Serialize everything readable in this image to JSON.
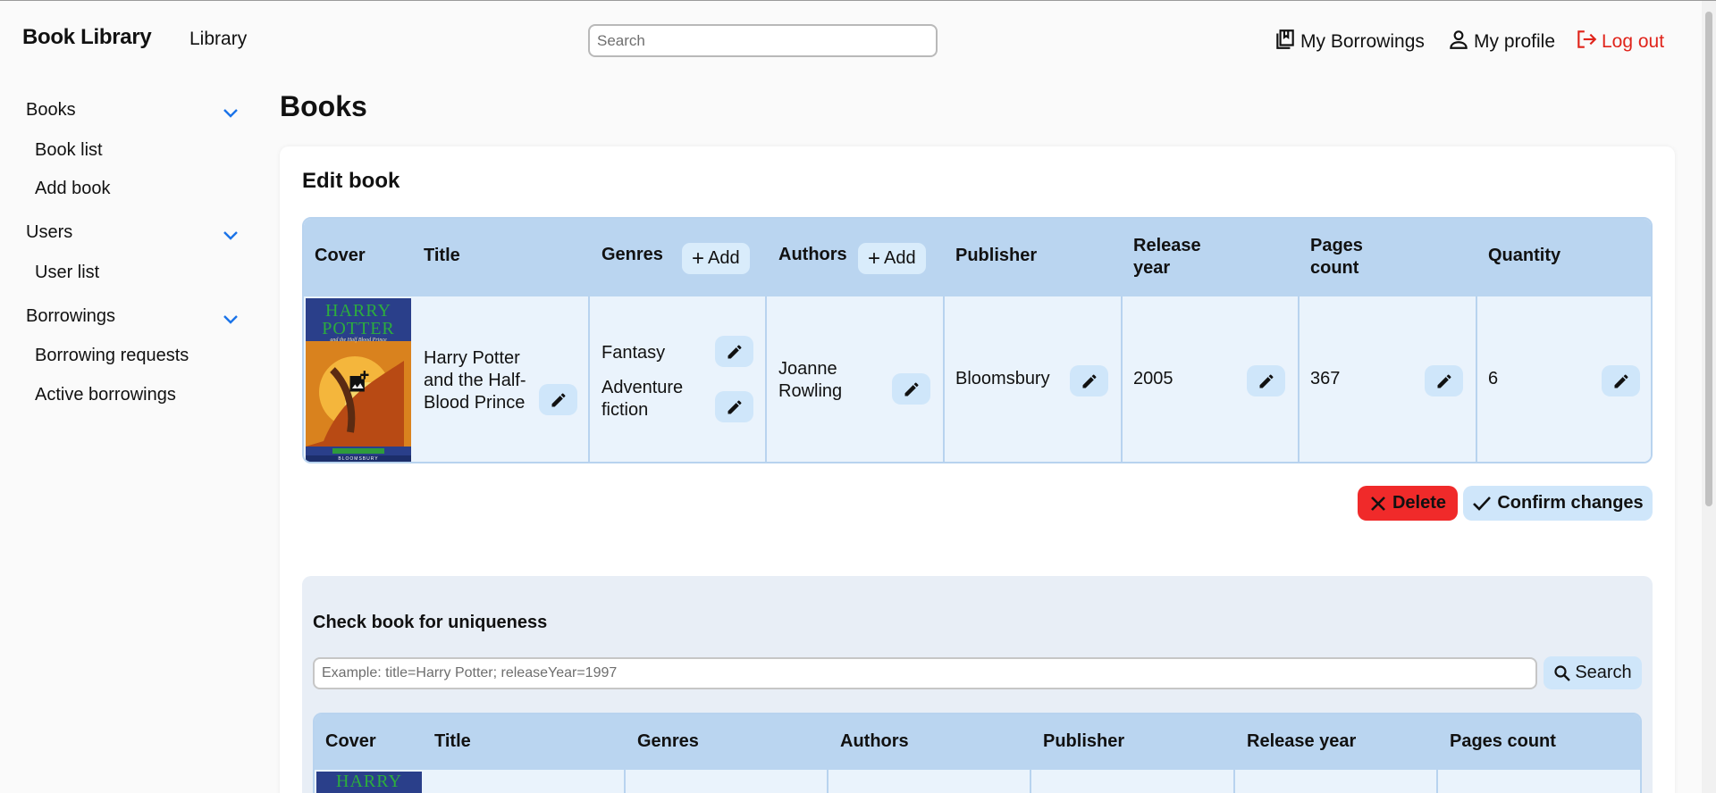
{
  "header": {
    "brand": "Book Library",
    "nav_library": "Library",
    "search_placeholder": "Search",
    "my_borrowings": "My Borrowings",
    "my_profile": "My profile",
    "log_out": "Log out"
  },
  "sidebar": {
    "groups": [
      {
        "label": "Books",
        "items": [
          "Book list",
          "Add book"
        ]
      },
      {
        "label": "Users",
        "items": [
          "User list"
        ]
      },
      {
        "label": "Borrowings",
        "items": [
          "Borrowing requests",
          "Active borrowings"
        ]
      }
    ]
  },
  "page": {
    "title": "Books",
    "card_title": "Edit book"
  },
  "edit_table": {
    "headers": {
      "cover": "Cover",
      "title": "Title",
      "genres": "Genres",
      "authors": "Authors",
      "publisher": "Publisher",
      "release_year": "Release year",
      "pages_count": "Pages count",
      "quantity": "Quantity"
    },
    "add_label": "Add",
    "row": {
      "cover_text_top": "HARRY",
      "cover_text_mid": "POTTER",
      "cover_subtitle": "and the Half Blood Prince",
      "cover_publisher": "BLOOMSBURY",
      "title": "Harry Potter and the Half-Blood Prince",
      "genres": [
        "Fantasy",
        "Adventure fiction"
      ],
      "authors": "Joanne Rowling",
      "publisher": "Bloomsbury",
      "release_year": "2005",
      "pages_count": "367",
      "quantity": "6"
    }
  },
  "actions": {
    "delete": "Delete",
    "confirm": "Confirm changes"
  },
  "uniqueness": {
    "title": "Check book for uniqueness",
    "placeholder": "Example: title=Harry Potter; releaseYear=1997",
    "search_button": "Search",
    "headers": [
      "Cover",
      "Title",
      "Genres",
      "Authors",
      "Publisher",
      "Release year",
      "Pages count"
    ],
    "cover_text_top": "HARRY"
  },
  "colors": {
    "accent_blue": "#1a73e8",
    "header_row": "#bad5f0",
    "body_row": "#eaf3fc",
    "danger": "#f02a2a",
    "logout": "#e0241b"
  }
}
